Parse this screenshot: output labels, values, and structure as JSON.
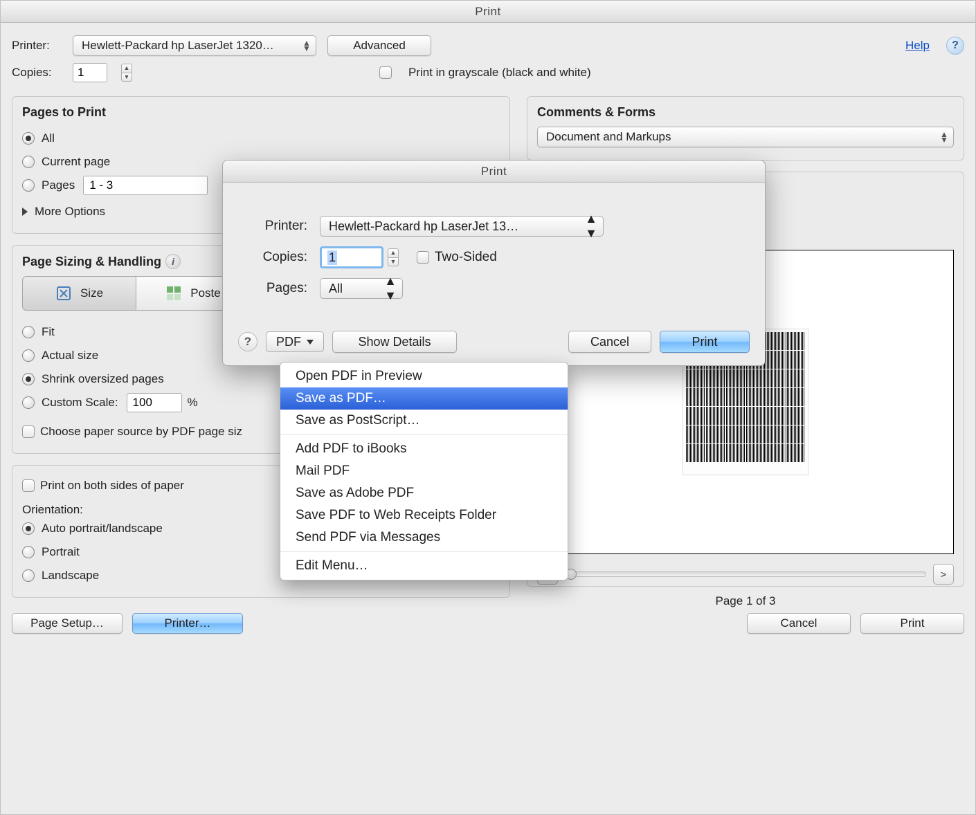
{
  "main_dialog": {
    "title": "Print",
    "printer_label": "Printer:",
    "printer_value": "Hewlett-Packard hp LaserJet 1320…",
    "advanced_btn": "Advanced",
    "help_link": "Help",
    "copies_label": "Copies:",
    "copies_value": "1",
    "grayscale_label": "Print in grayscale (black and white)",
    "footer": {
      "page_setup": "Page Setup…",
      "printer": "Printer…",
      "cancel": "Cancel",
      "print": "Print"
    }
  },
  "pages_panel": {
    "title": "Pages to Print",
    "option_all": "All",
    "option_current": "Current page",
    "option_pages": "Pages",
    "pages_value": "1 - 3",
    "more_options": "More Options"
  },
  "comments_panel": {
    "title": "Comments & Forms",
    "select_value": "Document and Markups"
  },
  "sizing_panel": {
    "title": "Page Sizing & Handling",
    "seg_size": "Size",
    "seg_poster": "Poste",
    "fit": "Fit",
    "actual": "Actual size",
    "shrink": "Shrink oversized pages",
    "custom": "Custom Scale:",
    "custom_value": "100",
    "custom_unit": "%",
    "choose_paper": "Choose paper source by PDF page siz"
  },
  "bottom_panel": {
    "both_sides": "Print on both sides of paper",
    "orientation_label": "Orientation:",
    "auto": "Auto portrait/landscape",
    "portrait": "Portrait",
    "landscape": "Landscape"
  },
  "preview": {
    "page_info": "Page 1 of 3"
  },
  "sub_dialog": {
    "title": "Print",
    "printer_label": "Printer:",
    "printer_value": "Hewlett-Packard hp LaserJet 13…",
    "copies_label": "Copies:",
    "copies_value": "1",
    "two_sided": "Two-Sided",
    "pages_label": "Pages:",
    "pages_value": "All",
    "pdf_btn": "PDF",
    "show_details": "Show Details",
    "cancel": "Cancel",
    "print": "Print"
  },
  "pdf_menu": {
    "open_preview": "Open PDF in Preview",
    "save_as_pdf": "Save as PDF…",
    "save_as_ps": "Save as PostScript…",
    "add_ibooks": "Add PDF to iBooks",
    "mail_pdf": "Mail PDF",
    "save_adobe": "Save as Adobe PDF",
    "save_receipts": "Save PDF to Web Receipts Folder",
    "send_messages": "Send PDF via Messages",
    "edit_menu": "Edit Menu…"
  }
}
